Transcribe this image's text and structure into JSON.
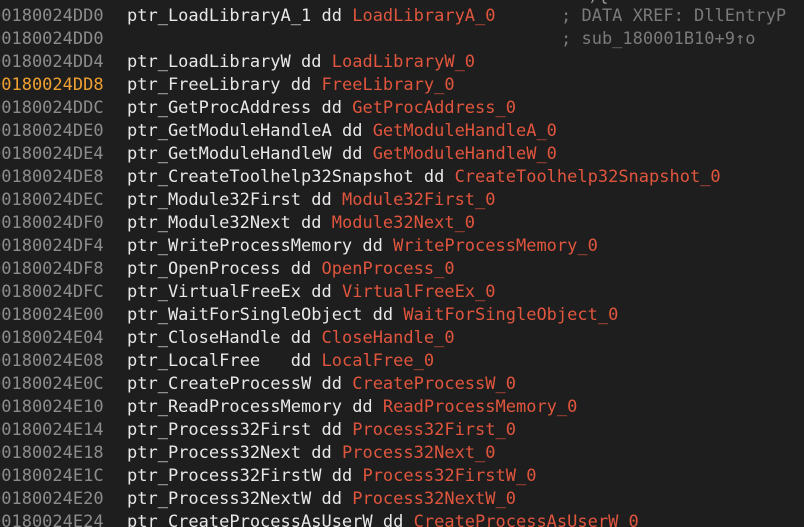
{
  "top_glyph": "){",
  "rows": [
    {
      "addr": "00180024DD0",
      "name": "ptr_LoadLibraryA_1",
      "gap": " ",
      "ref": "LoadLibraryA_0",
      "comment": "; DATA XREF: DllEntryP"
    },
    {
      "addr": "00180024DD0",
      "name": "",
      "gap": "",
      "ref": "",
      "comment": "; sub_180001B10+9↑o"
    },
    {
      "addr": "00180024DD4",
      "name": "ptr_LoadLibraryW",
      "gap": " ",
      "ref": "LoadLibraryW_0",
      "comment": ""
    },
    {
      "addr": "00180024DD8",
      "name": "ptr_FreeLibrary",
      "gap": " ",
      "ref": "FreeLibrary_0",
      "comment": "",
      "current": true
    },
    {
      "addr": "00180024DDC",
      "name": "ptr_GetProcAddress",
      "gap": " ",
      "ref": "GetProcAddress_0",
      "comment": ""
    },
    {
      "addr": "00180024DE0",
      "name": "ptr_GetModuleHandleA",
      "gap": " ",
      "ref": "GetModuleHandleA_0",
      "comment": ""
    },
    {
      "addr": "00180024DE4",
      "name": "ptr_GetModuleHandleW",
      "gap": " ",
      "ref": "GetModuleHandleW_0",
      "comment": ""
    },
    {
      "addr": "00180024DE8",
      "name": "ptr_CreateToolhelp32Snapshot",
      "gap": " ",
      "ref": "CreateToolhelp32Snapshot_0",
      "comment": ""
    },
    {
      "addr": "00180024DEC",
      "name": "ptr_Module32First",
      "gap": " ",
      "ref": "Module32First_0",
      "comment": ""
    },
    {
      "addr": "00180024DF0",
      "name": "ptr_Module32Next",
      "gap": " ",
      "ref": "Module32Next_0",
      "comment": ""
    },
    {
      "addr": "00180024DF4",
      "name": "ptr_WriteProcessMemory",
      "gap": " ",
      "ref": "WriteProcessMemory_0",
      "comment": ""
    },
    {
      "addr": "00180024DF8",
      "name": "ptr_OpenProcess",
      "gap": " ",
      "ref": "OpenProcess_0",
      "comment": ""
    },
    {
      "addr": "00180024DFC",
      "name": "ptr_VirtualFreeEx",
      "gap": " ",
      "ref": "VirtualFreeEx_0",
      "comment": ""
    },
    {
      "addr": "00180024E00",
      "name": "ptr_WaitForSingleObject",
      "gap": " ",
      "ref": "WaitForSingleObject_0",
      "comment": ""
    },
    {
      "addr": "00180024E04",
      "name": "ptr_CloseHandle",
      "gap": " ",
      "ref": "CloseHandle_0",
      "comment": ""
    },
    {
      "addr": "00180024E08",
      "name": "ptr_LocalFree",
      "gap": "   ",
      "ref": "LocalFree_0",
      "comment": ""
    },
    {
      "addr": "00180024E0C",
      "name": "ptr_CreateProcessW",
      "gap": " ",
      "ref": "CreateProcessW_0",
      "comment": ""
    },
    {
      "addr": "00180024E10",
      "name": "ptr_ReadProcessMemory",
      "gap": " ",
      "ref": "ReadProcessMemory_0",
      "comment": ""
    },
    {
      "addr": "00180024E14",
      "name": "ptr_Process32First",
      "gap": " ",
      "ref": "Process32First_0",
      "comment": ""
    },
    {
      "addr": "00180024E18",
      "name": "ptr_Process32Next",
      "gap": " ",
      "ref": "Process32Next_0",
      "comment": ""
    },
    {
      "addr": "00180024E1C",
      "name": "ptr_Process32FirstW",
      "gap": " ",
      "ref": "Process32FirstW_0",
      "comment": ""
    },
    {
      "addr": "00180024E20",
      "name": "ptr_Process32NextW",
      "gap": " ",
      "ref": "Process32NextW_0",
      "comment": ""
    },
    {
      "addr": "00180024E24",
      "name": "ptr_CreateProcessAsUserW",
      "gap": " ",
      "ref": "CreateProcessAsUserW_0",
      "comment": ""
    }
  ],
  "directive": "dd",
  "colors": {
    "background": "#1e1e1e",
    "address": "#8c8c8c",
    "current_address": "#f0a030",
    "name": "#e8e8e8",
    "reference": "#e0553d",
    "comment": "#7a7a7a"
  }
}
